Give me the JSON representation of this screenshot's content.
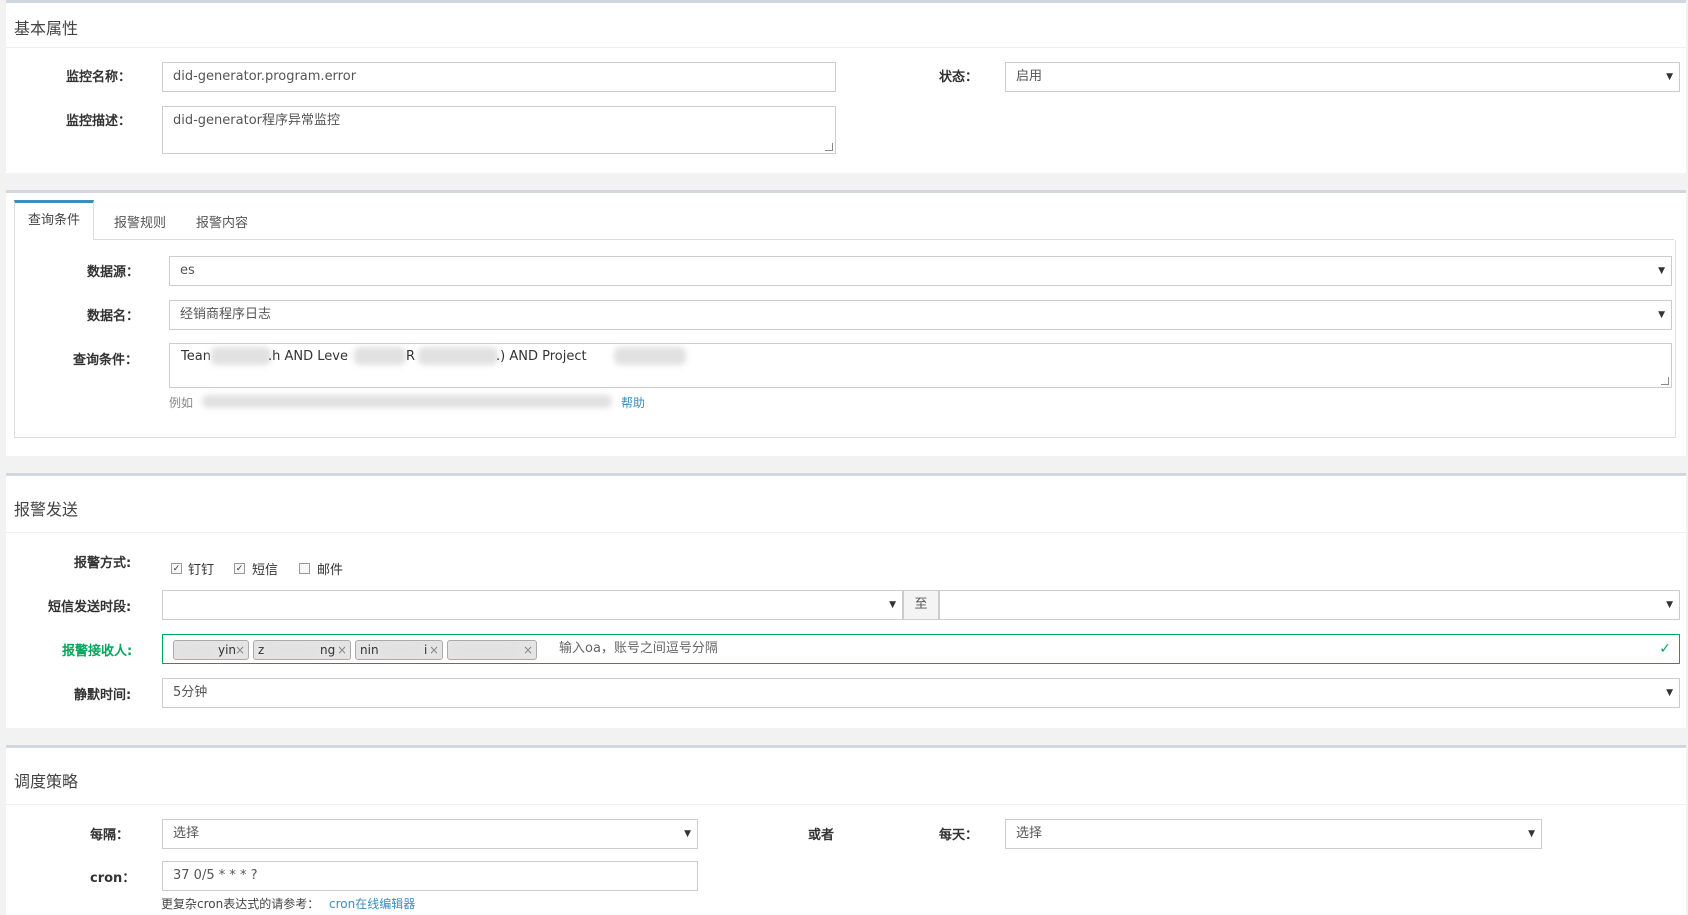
{
  "basic": {
    "title": "基本属性",
    "name_label": "监控名称：",
    "name_value": "did-generator.program.error",
    "status_label": "状态：",
    "status_value": "启用",
    "desc_label": "监控描述：",
    "desc_value": "did-generator程序异常监控"
  },
  "query": {
    "tabs": [
      "查询条件",
      "报警规则",
      "报警内容"
    ],
    "source_label": "数据源：",
    "source_value": "es",
    "dataname_label": "数据名：",
    "dataname_value": "经销商程序日志",
    "cond_label": "查询条件：",
    "cond_parts": [
      "Tean",
      ".h AND Leve",
      "R",
      ".) AND Project"
    ],
    "example_prefix": "例如",
    "help_link": "帮助"
  },
  "alert": {
    "title": "报警发送",
    "method_label": "报警方式:",
    "methods": [
      {
        "label": "钉钉",
        "checked": true
      },
      {
        "label": "短信",
        "checked": true
      },
      {
        "label": "邮件",
        "checked": false
      }
    ],
    "sms_label": "短信发送时段:",
    "to_label": "至",
    "recv_label": "报警接收人:",
    "recv_tags": [
      "yin",
      "z",
      "ng",
      "nin",
      "i"
    ],
    "recv_placeholder": "输入oa，账号之间逗号分隔",
    "silence_label": "静默时间:",
    "silence_value": "5分钟"
  },
  "schedule": {
    "title": "调度策略",
    "every_label": "每隔：",
    "every_value": "选择",
    "or_label": "或者",
    "daily_label": "每天：",
    "daily_value": "选择",
    "cron_label": "cron：",
    "cron_value": "37 0/5 * * * ?",
    "hint_prefix": "更复杂cron表达式的请参考：",
    "hint_link": "cron在线编辑器"
  },
  "colors": {
    "accent": "#3c8dbc",
    "success": "#00a65a"
  }
}
